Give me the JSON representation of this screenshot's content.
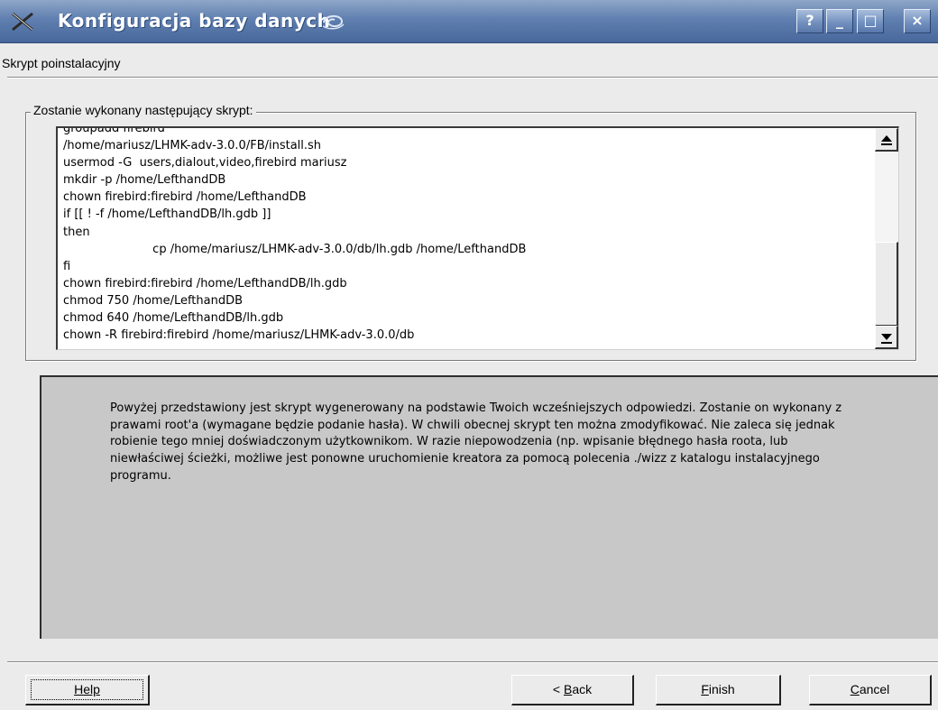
{
  "window": {
    "title": "Konfiguracja bazy danych"
  },
  "header": {
    "page_title": "Skrypt poinstalacyjny"
  },
  "script_group": {
    "label": "Zostanie wykonany następujący skrypt:",
    "lines": [
      "groupadd firebird",
      "/home/mariusz/LHMK-adv-3.0.0/FB/install.sh",
      "usermod -G  users,dialout,video,firebird mariusz",
      "mkdir -p /home/LefthandDB",
      "chown firebird:firebird /home/LefthandDB",
      "if [[ ! -f /home/LefthandDB/lh.gdb ]]",
      "then",
      "                        cp /home/mariusz/LHMK-adv-3.0.0/db/lh.gdb /home/LefthandDB",
      "fi",
      "chown firebird:firebird /home/LefthandDB/lh.gdb",
      "chmod 750 /home/LefthandDB",
      "chmod 640 /home/LefthandDB/lh.gdb",
      "chown -R firebird:firebird /home/mariusz/LHMK-adv-3.0.0/db"
    ]
  },
  "info": {
    "text": "Powyżej przedstawiony jest skrypt wygenerowany na podstawie Twoich wcześniejszych odpowiedzi. Zostanie on wykonany z prawami root'a (wymagane będzie podanie hasła). W chwili obecnej skrypt ten można zmodyfikować. Nie zaleca się jednak robienie tego mniej doświadczonym użytkownikom. W razie niepowodzenia (np. wpisanie błędnego hasła roota, lub niewłaściwej ścieżki, możliwe jest ponowne uruchomienie kreatora za pomocą polecenia ./wizz z katalogu instalacyjnego programu."
  },
  "buttons": {
    "help": {
      "accel": "H",
      "rest": "elp"
    },
    "back": {
      "prefix": "< ",
      "accel": "B",
      "rest": "ack"
    },
    "finish": {
      "accel": "F",
      "rest": "inish"
    },
    "cancel": {
      "accel": "C",
      "rest": "ancel"
    }
  },
  "titlebar_buttons": {
    "help": "?",
    "minimize": "_",
    "maximize": "□",
    "close": "×"
  },
  "icons": {
    "app": "x-icon",
    "title_decoration": "swirl-icon"
  },
  "colors": {
    "titlebar": "#5f7fb0",
    "window_bg": "#ebebeb",
    "info_panel_bg": "#c8c8c8"
  }
}
